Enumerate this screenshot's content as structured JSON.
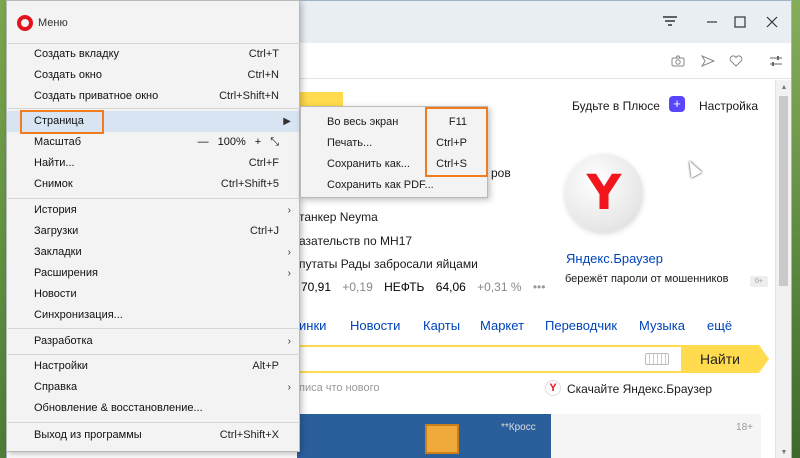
{
  "menu": {
    "title": "Меню",
    "items": [
      {
        "label": "Создать вкладку",
        "shortcut": "Ctrl+T"
      },
      {
        "label": "Создать окно",
        "shortcut": "Ctrl+N"
      },
      {
        "label": "Создать приватное окно",
        "shortcut": "Ctrl+Shift+N"
      },
      {
        "label": "Страница",
        "shortcut": ""
      },
      {
        "label": "Масштаб",
        "shortcut": ""
      },
      {
        "label": "Найти...",
        "shortcut": "Ctrl+F"
      },
      {
        "label": "Снимок",
        "shortcut": "Ctrl+Shift+5"
      },
      {
        "label": "История",
        "shortcut": ""
      },
      {
        "label": "Загрузки",
        "shortcut": "Ctrl+J"
      },
      {
        "label": "Закладки",
        "shortcut": ""
      },
      {
        "label": "Расширения",
        "shortcut": ""
      },
      {
        "label": "Новости",
        "shortcut": ""
      },
      {
        "label": "Синхронизация...",
        "shortcut": ""
      },
      {
        "label": "Разработка",
        "shortcut": ""
      },
      {
        "label": "Настройки",
        "shortcut": "Alt+P"
      },
      {
        "label": "Справка",
        "shortcut": ""
      },
      {
        "label": "Обновление & восстановление...",
        "shortcut": ""
      },
      {
        "label": "Выход из программы",
        "shortcut": "Ctrl+Shift+X"
      }
    ],
    "zoom": {
      "minus": "—",
      "value": "100%",
      "plus": "+",
      "fullscreen": "⤡"
    }
  },
  "submenu": {
    "items": [
      {
        "label": "Во весь экран",
        "shortcut": "F11"
      },
      {
        "label": "Печать...",
        "shortcut": "Ctrl+P"
      },
      {
        "label": "Сохранить как...",
        "shortcut": "Ctrl+S"
      },
      {
        "label": "Сохранить как PDF...",
        "shortcut": ""
      }
    ]
  },
  "page": {
    "plus_text": "Будьте в Плюсе",
    "plus_icon": "+",
    "settings": "Настройка",
    "partial": "ров",
    "news": [
      "танкер Neyma",
      "азательств по МН17",
      "путаты Рады забросали яйцами"
    ],
    "rates": {
      "v1": "70,91",
      "c1": "+0,19",
      "oil_label": "НЕФТЬ",
      "v2": "64,06",
      "c2": "+0,31 %",
      "more": "•••"
    },
    "promo": {
      "title": "Яндекс.Браузер",
      "subtitle": "бережёт пароли от мошенников",
      "badge": "0+",
      "logo_letter": "Y"
    },
    "services": [
      "инки",
      "Новости",
      "Карты",
      "Маркет",
      "Переводчик",
      "Музыка",
      "ещё"
    ],
    "search_button": "Найти",
    "hint": "писа что нового",
    "download": {
      "icon": "Y",
      "text": "Скачайте Яндекс.Браузер"
    },
    "ad": {
      "text": "**Кросс",
      "age": "18+"
    }
  }
}
